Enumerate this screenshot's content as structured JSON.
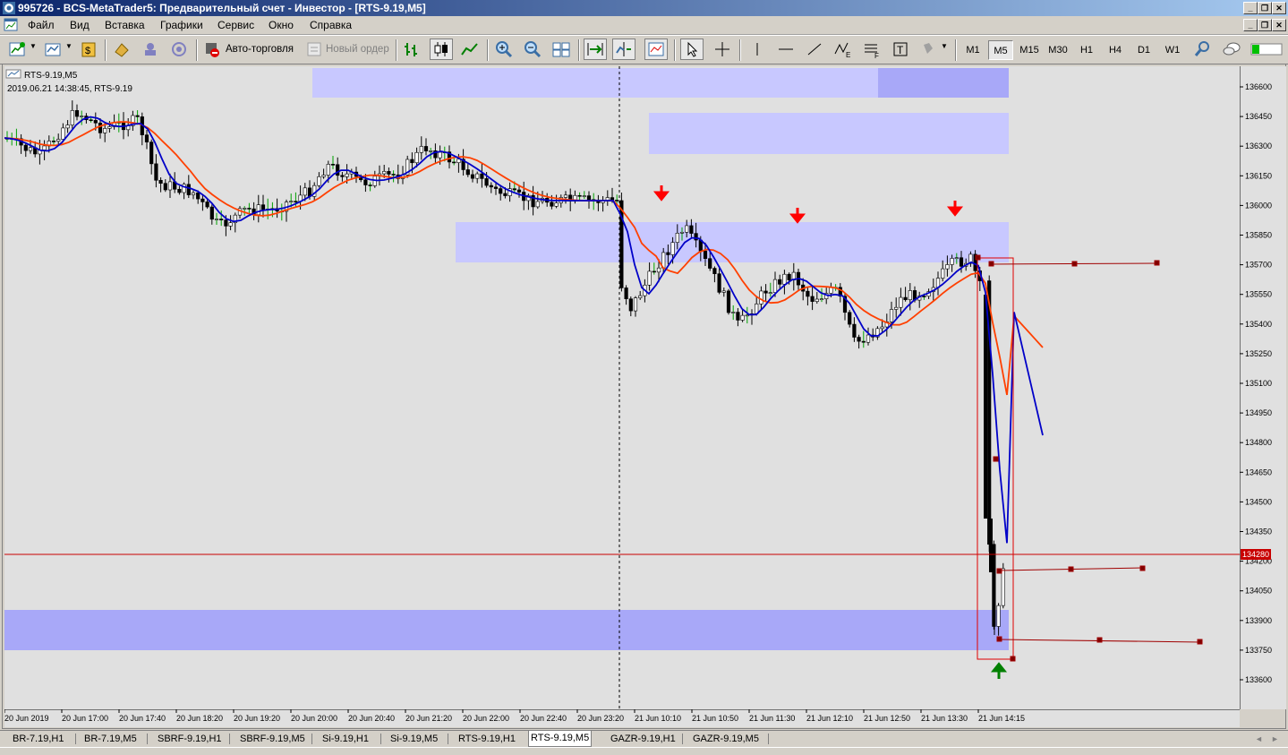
{
  "window": {
    "title": "995726 - BCS-MetaTrader5: Предварительный счет - Инвестор - [RTS-9.19,M5]",
    "controls": [
      "_",
      "❐",
      "✕"
    ]
  },
  "menu": [
    "Файл",
    "Вид",
    "Вставка",
    "Графики",
    "Сервис",
    "Окно",
    "Справка"
  ],
  "toolbar": {
    "autotrade_label": "Авто-торговля",
    "new_order_label": "Новый ордер",
    "timeframes": [
      "M1",
      "M5",
      "M15",
      "M30",
      "H1",
      "H4",
      "D1",
      "W1"
    ],
    "active_timeframe": "M5"
  },
  "chart": {
    "window_label": "RTS-9.19,M5",
    "info_line": "2019.06.21 14:38:45, RTS-9.19",
    "current_price": "134280",
    "price_axis": [
      "136600",
      "136450",
      "136300",
      "136150",
      "136000",
      "135850",
      "135700",
      "135550",
      "135400",
      "135250",
      "135100",
      "134950",
      "134800",
      "134650",
      "134500",
      "134350",
      "134200",
      "134050",
      "133900",
      "133750",
      "133600"
    ],
    "time_axis": [
      "20 Jun 2019",
      "20 Jun 17:00",
      "20 Jun 17:40",
      "20 Jun 18:20",
      "20 Jun 19:20",
      "20 Jun 20:00",
      "20 Jun 20:40",
      "20 Jun 21:20",
      "20 Jun 22:00",
      "20 Jun 22:40",
      "20 Jun 23:20",
      "21 Jun 10:10",
      "21 Jun 10:50",
      "21 Jun 11:30",
      "21 Jun 12:10",
      "21 Jun 12:50",
      "21 Jun 13:30",
      "21 Jun 14:15"
    ],
    "colors": {
      "background": "#e0e0e0",
      "bull_candle": "#ffffff",
      "bear_candle": "#000000",
      "ma_fast": "#0000c8",
      "ma_slow": "#ff4000",
      "zone": "#c8c8ff",
      "zone_dark": "#a8a8f8",
      "price_line": "#c80000",
      "arrow_down": "#ff0000",
      "arrow_up": "#008000"
    }
  },
  "tabs": [
    "BR-7.19,H1",
    "BR-7.19,M5",
    "SBRF-9.19,H1",
    "SBRF-9.19,M5",
    "Si-9.19,H1",
    "Si-9.19,M5",
    "RTS-9.19,H1",
    "RTS-9.19,M5",
    "GAZR-9.19,H1",
    "GAZR-9.19,M5"
  ],
  "active_tab": "RTS-9.19,M5"
}
